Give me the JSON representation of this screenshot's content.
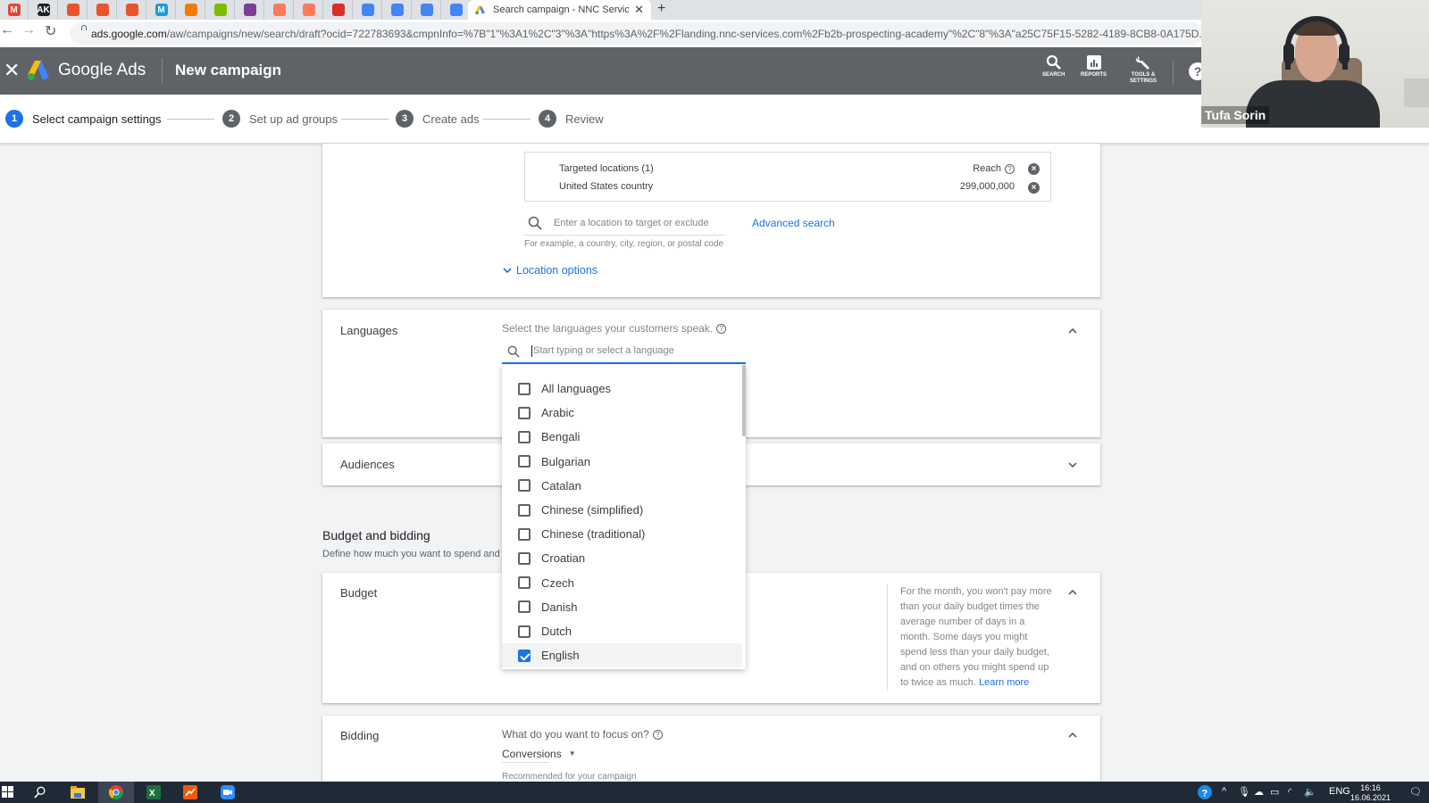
{
  "browser": {
    "pinned_tabs": [
      {
        "icon": "gmail-icon",
        "glyph": "M",
        "color": "#ea4335"
      },
      {
        "icon": "ak-icon",
        "glyph": "AK",
        "color": "#222222"
      },
      {
        "icon": "app-icon",
        "glyph": "",
        "color": "#e8542c"
      },
      {
        "icon": "app-icon",
        "glyph": "",
        "color": "#e8542c"
      },
      {
        "icon": "app-icon",
        "glyph": "",
        "color": "#e8542c"
      },
      {
        "icon": "m-icon",
        "glyph": "M",
        "color": "#1a9cd8"
      },
      {
        "icon": "circle-app-icon",
        "glyph": "",
        "color": "#f57c00"
      },
      {
        "icon": "microsoft-icon",
        "glyph": "",
        "color": "#7cbb00"
      },
      {
        "icon": "app-icon",
        "glyph": "",
        "color": "#7b3f94"
      },
      {
        "icon": "hubspot-icon",
        "glyph": "",
        "color": "#ff7a59"
      },
      {
        "icon": "hubspot-icon",
        "glyph": "",
        "color": "#ff7a59"
      },
      {
        "icon": "app-icon",
        "glyph": "",
        "color": "#d93025"
      },
      {
        "icon": "workflow-icon",
        "glyph": "",
        "color": "#4285f4"
      },
      {
        "icon": "workflow-icon",
        "glyph": "",
        "color": "#4285f4"
      },
      {
        "icon": "workflow-icon",
        "glyph": "",
        "color": "#4285f4"
      },
      {
        "icon": "workflow-icon",
        "glyph": "",
        "color": "#4285f4"
      }
    ],
    "active_tab_title": "Search campaign - NNC Services",
    "url_domain": "ads.google.com",
    "url_path": "/aw/campaigns/new/search/draft?ocid=722783693&cmpnInfo=%7B\"1\"%3A1%2C\"3\"%3A\"https%3A%2F%2Flanding.nnc-services.com%2Fb2b-prospecting-academy\"%2C\"8\"%3A\"a25C75F15-5282-4189-8CB8-0A175D..."
  },
  "header": {
    "brand": "Google Ads",
    "title": "New campaign",
    "tools": [
      {
        "label": "SEARCH",
        "icon": "search-icon"
      },
      {
        "label": "REPORTS",
        "icon": "reports-icon"
      },
      {
        "label": "TOOLS & SETTINGS",
        "icon": "wrench-icon"
      }
    ],
    "help": "?"
  },
  "stepper": {
    "steps": [
      {
        "num": "1",
        "label": "Select campaign settings",
        "active": true
      },
      {
        "num": "2",
        "label": "Set up ad groups",
        "active": false
      },
      {
        "num": "3",
        "label": "Create ads",
        "active": false
      },
      {
        "num": "4",
        "label": "Review",
        "active": false
      }
    ]
  },
  "locations": {
    "targeted_header": "Targeted locations (1)",
    "reach_label": "Reach",
    "items": [
      {
        "name": "United States country",
        "reach": "299,000,000"
      }
    ],
    "search_placeholder": "Enter a location to target or exclude",
    "advanced_search": "Advanced search",
    "hint": "For example, a country, city, region, or postal code",
    "options_link": "Location options"
  },
  "languages": {
    "label": "Languages",
    "prompt": "Select the languages your customers speak.",
    "search_placeholder": "Start typing or select a language",
    "options": [
      {
        "label": "All languages",
        "checked": false
      },
      {
        "label": "Arabic",
        "checked": false
      },
      {
        "label": "Bengali",
        "checked": false
      },
      {
        "label": "Bulgarian",
        "checked": false
      },
      {
        "label": "Catalan",
        "checked": false
      },
      {
        "label": "Chinese (simplified)",
        "checked": false
      },
      {
        "label": "Chinese (traditional)",
        "checked": false
      },
      {
        "label": "Croatian",
        "checked": false
      },
      {
        "label": "Czech",
        "checked": false
      },
      {
        "label": "Danish",
        "checked": false
      },
      {
        "label": "Dutch",
        "checked": false
      },
      {
        "label": "English",
        "checked": true
      }
    ]
  },
  "audiences": {
    "label": "Audiences"
  },
  "budget_bidding": {
    "title": "Budget and bidding",
    "subtitle": "Define how much you want to spend and",
    "budget_label": "Budget",
    "budget_tip": "For the month, you won't pay more than your daily budget times the average number of days in a month. Some days you might spend less than your daily budget, and on others you might spend up to twice as much.",
    "learn_more": "Learn more",
    "bidding_label": "Bidding",
    "bidding_question": "What do you want to focus on?",
    "bidding_value": "Conversions",
    "bidding_hint": "Recommended for your campaign"
  },
  "webcam": {
    "name": "Tufa Sorin"
  },
  "taskbar": {
    "apps": [
      "windows-start-icon",
      "search-icon",
      "file-explorer-icon",
      "chrome-icon",
      "excel-icon",
      "app-icon",
      "zoom-icon"
    ],
    "language": "ENG",
    "time": "16:16",
    "date": "16.06.2021"
  },
  "colors": {
    "accent": "#1a73e8",
    "header_bg": "#5f6368",
    "page_bg": "#f1f3f4"
  }
}
